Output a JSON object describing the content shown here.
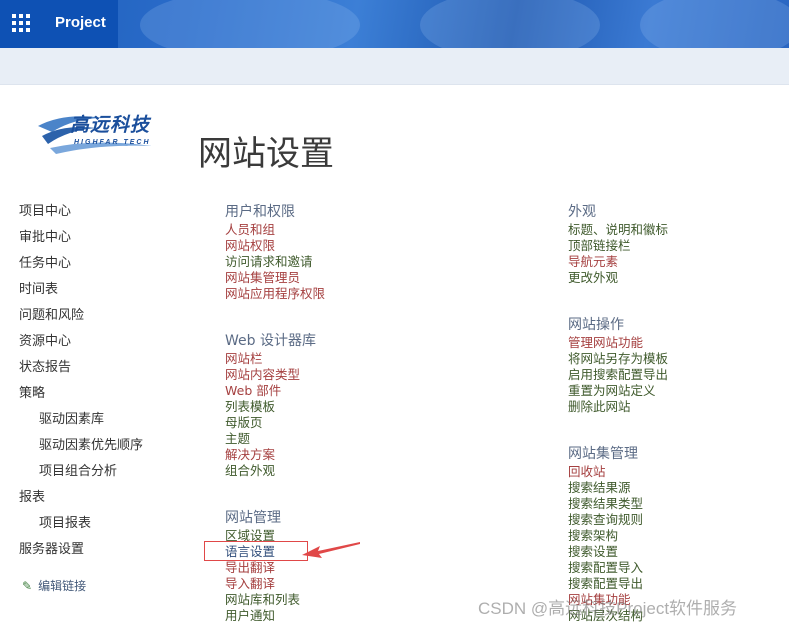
{
  "header": {
    "title": "Project",
    "menu_icon": "waffle-icon"
  },
  "logo": {
    "text_cn": "高远科技",
    "text_en": "HIGHFAR TECH"
  },
  "page_title": "网站设置",
  "quick_launch": {
    "items": [
      {
        "label": "项目中心",
        "level": 0
      },
      {
        "label": "审批中心",
        "level": 0
      },
      {
        "label": "任务中心",
        "level": 0
      },
      {
        "label": "时间表",
        "level": 0
      },
      {
        "label": "问题和风险",
        "level": 0
      },
      {
        "label": "资源中心",
        "level": 0
      },
      {
        "label": "状态报告",
        "level": 0
      },
      {
        "label": "策略",
        "level": 0
      },
      {
        "label": "驱动因素库",
        "level": 1
      },
      {
        "label": "驱动因素优先顺序",
        "level": 1
      },
      {
        "label": "项目组合分析",
        "level": 1
      },
      {
        "label": "报表",
        "level": 0
      },
      {
        "label": "项目报表",
        "level": 1
      },
      {
        "label": "服务器设置",
        "level": 0
      }
    ],
    "edit_links": "编辑链接"
  },
  "sections": {
    "users_permissions": {
      "title": "用户和权限",
      "links": [
        {
          "label": "人员和组",
          "color": "red"
        },
        {
          "label": "网站权限",
          "color": "red"
        },
        {
          "label": "访问请求和邀请",
          "color": "green"
        },
        {
          "label": "网站集管理员",
          "color": "red"
        },
        {
          "label": "网站应用程序权限",
          "color": "red"
        }
      ]
    },
    "web_designer": {
      "title": "Web 设计器库",
      "links": [
        {
          "label": "网站栏",
          "color": "red"
        },
        {
          "label": "网站内容类型",
          "color": "red"
        },
        {
          "label": "Web 部件",
          "color": "red"
        },
        {
          "label": "列表模板",
          "color": "green"
        },
        {
          "label": "母版页",
          "color": "green"
        },
        {
          "label": "主题",
          "color": "green"
        },
        {
          "label": "解决方案",
          "color": "red"
        },
        {
          "label": "组合外观",
          "color": "green"
        }
      ]
    },
    "site_admin": {
      "title": "网站管理",
      "links": [
        {
          "label": "区域设置",
          "color": "green"
        },
        {
          "label": "语言设置",
          "color": "blue"
        },
        {
          "label": "导出翻译",
          "color": "red"
        },
        {
          "label": "导入翻译",
          "color": "red"
        },
        {
          "label": "网站库和列表",
          "color": "green"
        },
        {
          "label": "用户通知",
          "color": "green"
        }
      ]
    },
    "look_feel": {
      "title": "外观",
      "links": [
        {
          "label": "标题、说明和徽标",
          "color": "green"
        },
        {
          "label": "顶部链接栏",
          "color": "green"
        },
        {
          "label": "导航元素",
          "color": "red"
        },
        {
          "label": "更改外观",
          "color": "green"
        }
      ]
    },
    "site_actions": {
      "title": "网站操作",
      "links": [
        {
          "label": "管理网站功能",
          "color": "red"
        },
        {
          "label": "将网站另存为模板",
          "color": "green"
        },
        {
          "label": "启用搜索配置导出",
          "color": "green"
        },
        {
          "label": "重置为网站定义",
          "color": "green"
        },
        {
          "label": "删除此网站",
          "color": "green"
        }
      ]
    },
    "site_collection_admin": {
      "title": "网站集管理",
      "links": [
        {
          "label": "回收站",
          "color": "red"
        },
        {
          "label": "搜索结果源",
          "color": "green"
        },
        {
          "label": "搜索结果类型",
          "color": "green"
        },
        {
          "label": "搜索查询规则",
          "color": "green"
        },
        {
          "label": "搜索架构",
          "color": "green"
        },
        {
          "label": "搜索设置",
          "color": "green"
        },
        {
          "label": "搜索配置导入",
          "color": "green"
        },
        {
          "label": "搜索配置导出",
          "color": "green"
        },
        {
          "label": "网站集功能",
          "color": "red"
        },
        {
          "label": "网站层次结构",
          "color": "green"
        }
      ]
    }
  },
  "watermark": "CSDN @高远科技Project软件服务",
  "colors": {
    "header": "#1f5fb8",
    "brand": "#0e51b4",
    "link_red": "#a54040",
    "link_green": "#3f5a2c",
    "highlight": "#e04848"
  }
}
